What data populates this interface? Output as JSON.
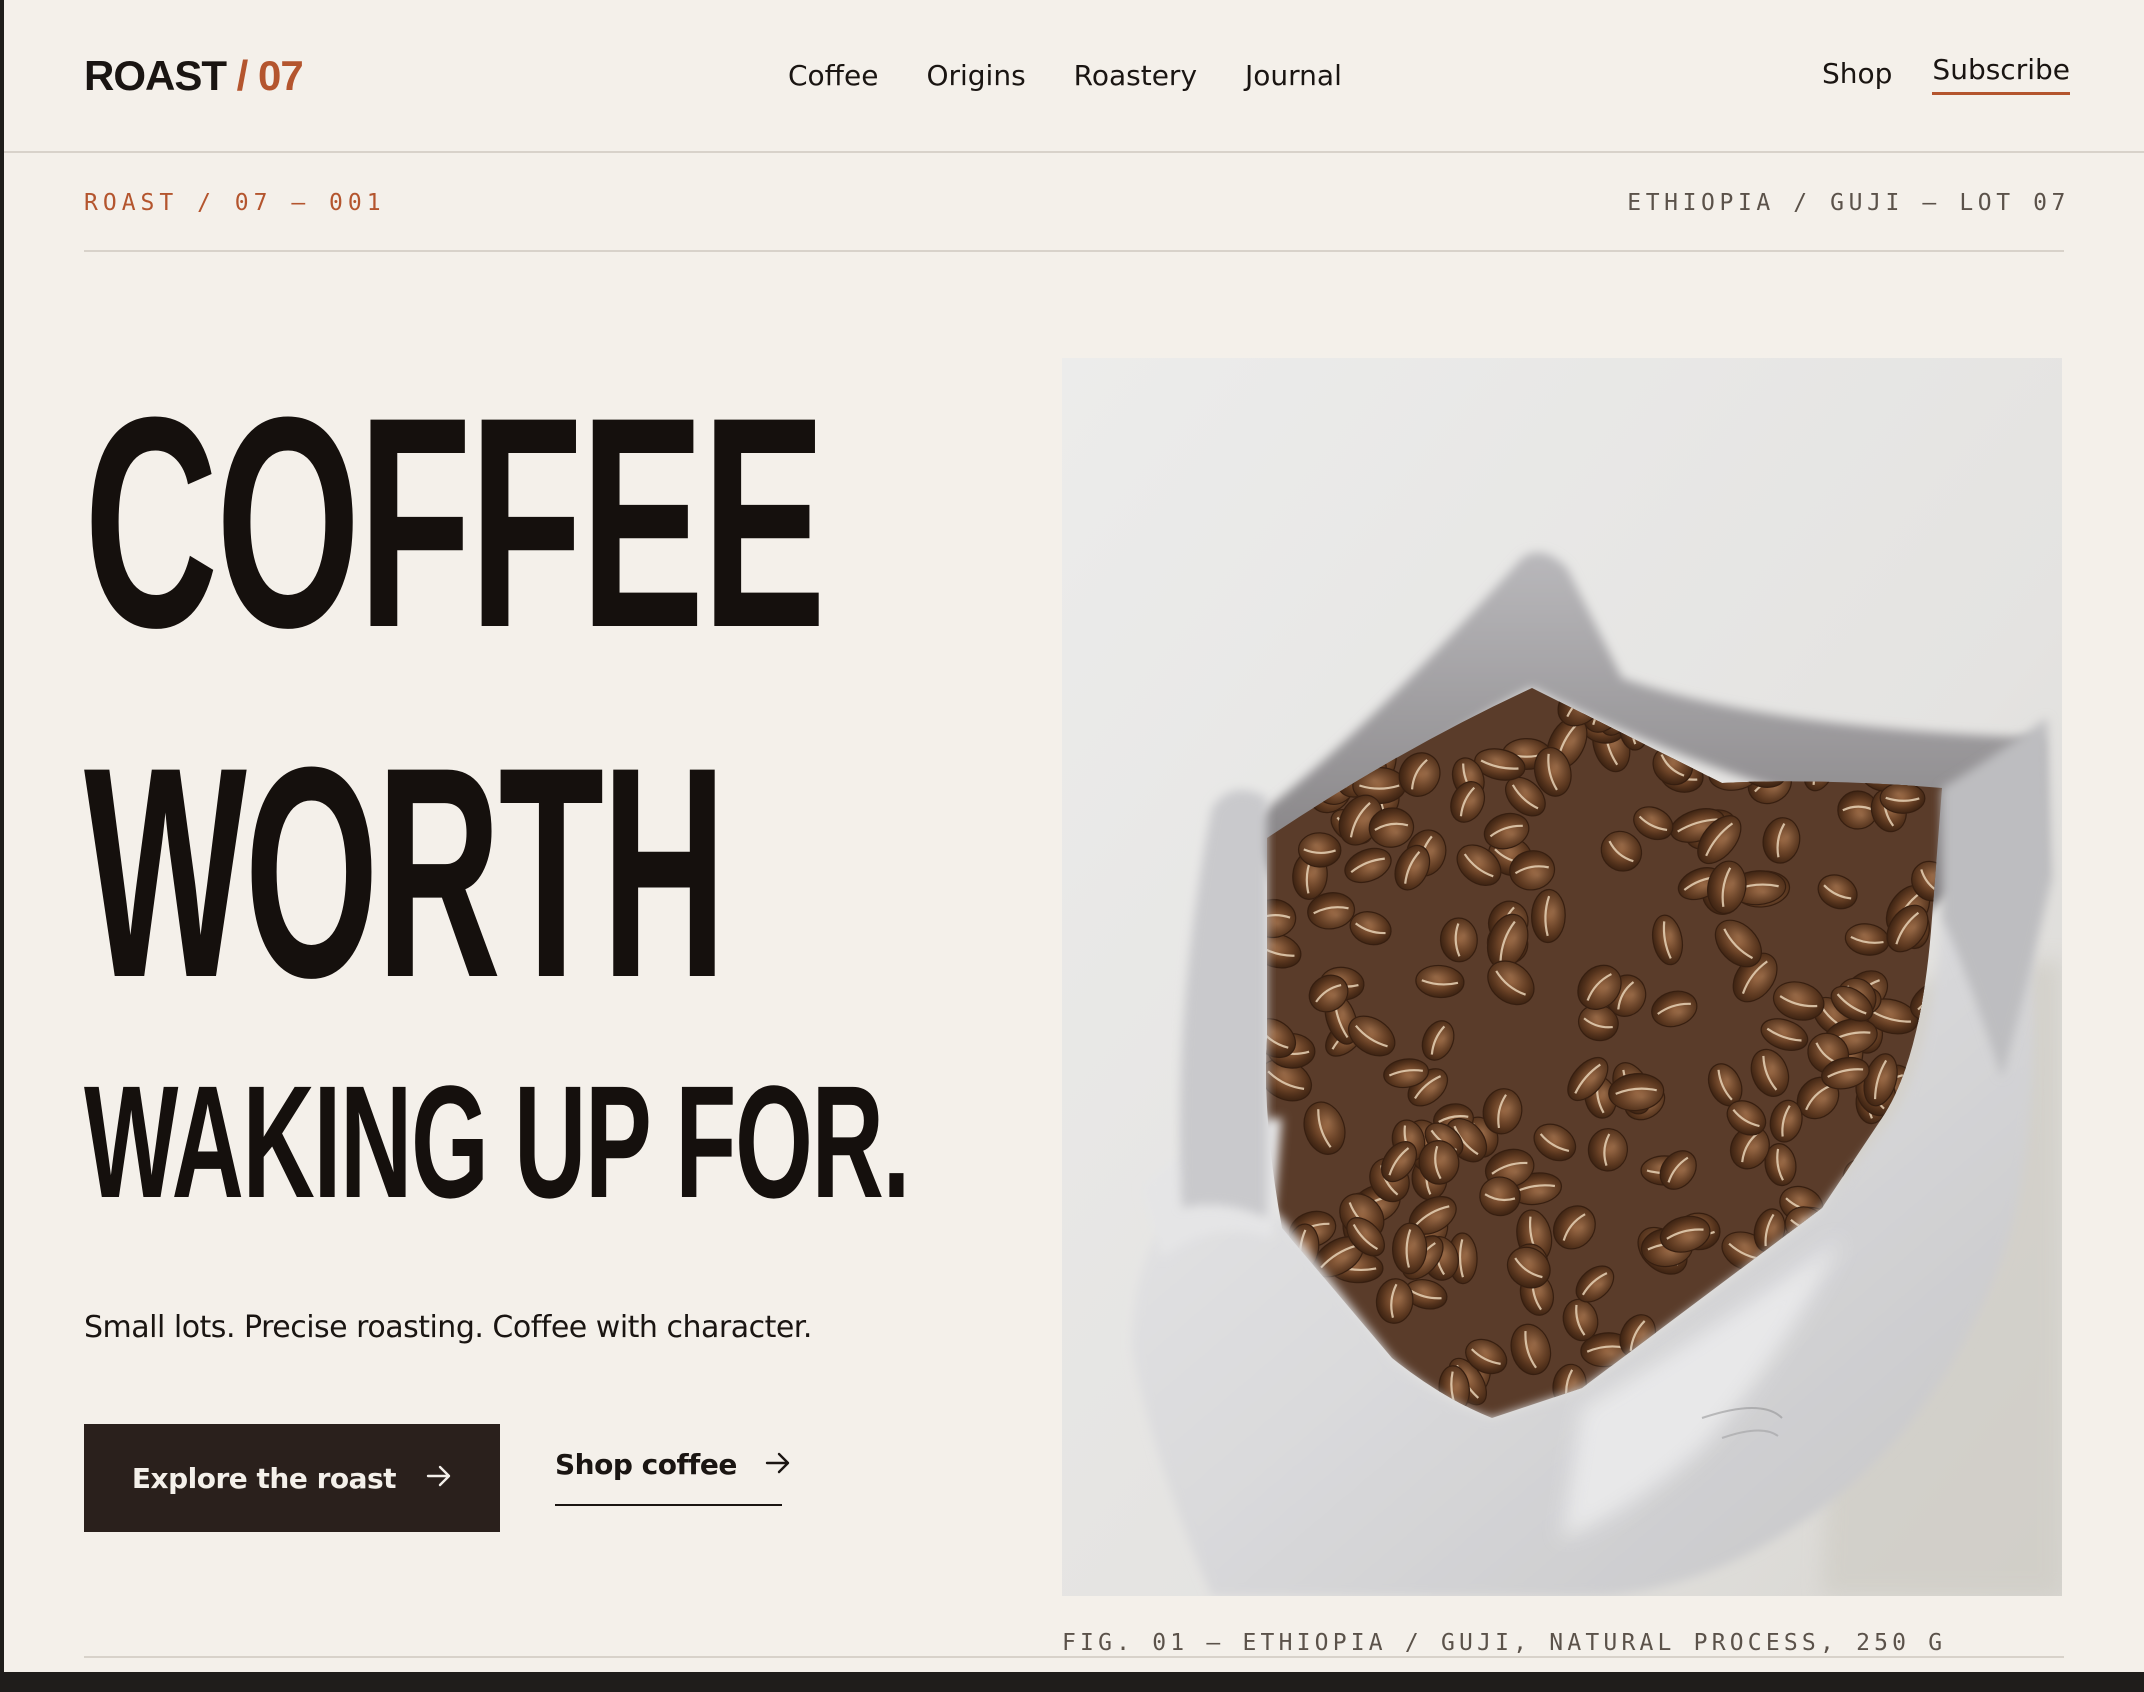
{
  "brand": {
    "name": "ROAST",
    "separator": " / ",
    "number": "07"
  },
  "nav": {
    "items": [
      "Coffee",
      "Origins",
      "Roastery",
      "Journal"
    ],
    "shop": "Shop",
    "subscribe": "Subscribe"
  },
  "meta": {
    "left": "ROAST / 07 — 001",
    "right": "ETHIOPIA / GUJI — LOT 07"
  },
  "hero": {
    "line1": "COFFEE",
    "line2": "WORTH",
    "line3": "WAKING UP FOR.",
    "tagline": "Small lots. Precise roasting. Coffee with character.",
    "primary_cta": "Explore the roast",
    "secondary_cta": "Shop coffee",
    "photo_subject": "open bag of roasted coffee beans",
    "caption": "FIG. 01 — ETHIOPIA / GUJI, NATURAL PROCESS, 250 G"
  },
  "colors": {
    "background": "#f4f0ea",
    "ink": "#15100d",
    "accent": "#b4552e",
    "button": "#2a201c",
    "muted": "#5b524a",
    "rule": "#d8d2ca"
  },
  "icons": {
    "cta_arrow": "arrow-right-icon"
  }
}
